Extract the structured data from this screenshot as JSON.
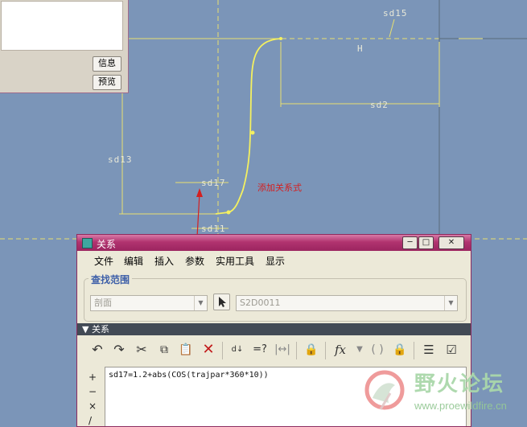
{
  "sketch": {
    "dim_labels": {
      "sd15": "sd15",
      "h": "H",
      "sd2": "sd2",
      "sd13": "sd13",
      "sd17": "sd17",
      "sd11": "sd11"
    },
    "annotation": "添加关系式"
  },
  "partial_dialog": {
    "info_button": "信息",
    "preview_button": "预览"
  },
  "relations_dialog": {
    "title": "关系",
    "window_controls": {
      "minimize": "─",
      "maximize": "□",
      "close": "✕"
    },
    "menu": [
      "文件",
      "编辑",
      "插入",
      "参数",
      "实用工具",
      "显示"
    ],
    "lookin": {
      "label": "查找范围",
      "type_value": "剖面",
      "object_value": "S2D0011"
    },
    "section_label": "关系",
    "toolbar_icons": [
      "undo-icon",
      "redo-icon",
      "cut-icon",
      "copy-icon",
      "paste-icon",
      "delete-icon",
      "sort-relations-icon",
      "evaluate-icon",
      "dimension-toggle-icon",
      "lock-icon",
      "insert-function-icon",
      "insert-parentheses-icon",
      "parameter-lock-icon",
      "export-icon",
      "verify-icon"
    ],
    "gutter": [
      "+",
      "−",
      "×",
      "/"
    ],
    "relation_text": "sd17=1.2+abs(COS(trajpar*360*10))"
  },
  "watermark": {
    "cn": "野火论坛",
    "url": "www.proewildfire.cn"
  },
  "colors": {
    "background": "#7b95b8",
    "sketch_yellow": "#f4f060",
    "annotation_red": "#d42020",
    "titlebar": "#b1336f"
  }
}
